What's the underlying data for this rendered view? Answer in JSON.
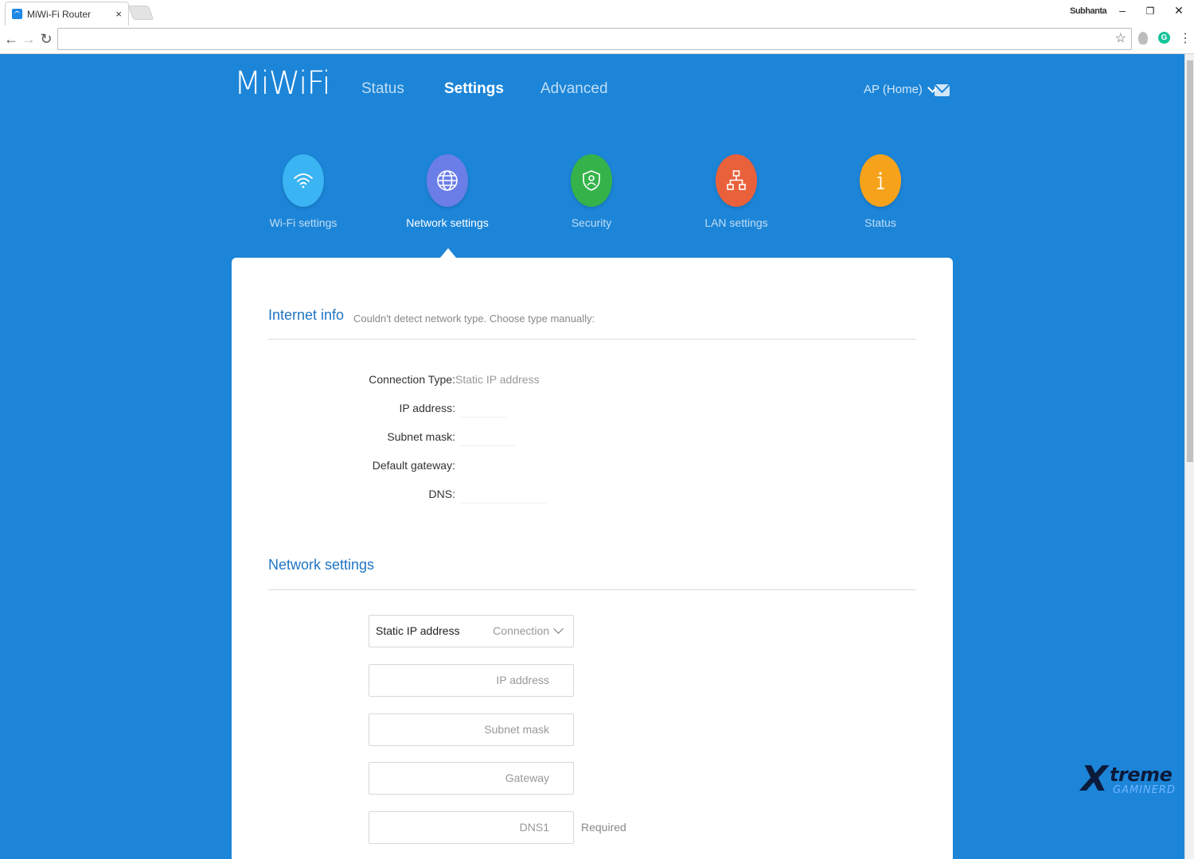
{
  "browser": {
    "tab_title": "MiWi-Fi Router",
    "tab_close": "×",
    "profile_name": "Subhanta",
    "minimize": "–",
    "restore": "❐",
    "close": "✕",
    "back": "←",
    "forward": "→",
    "reload": "↻",
    "url": "",
    "bookmark": "☆",
    "menu": "⋮",
    "extension_g": "G"
  },
  "header": {
    "logo": "MiWiFi",
    "nav": [
      {
        "label": "Status",
        "active": false
      },
      {
        "label": "Settings",
        "active": true
      },
      {
        "label": "Advanced",
        "active": false
      }
    ],
    "mode": "AP (Home)",
    "mail_icon": "mail-icon"
  },
  "categories": [
    {
      "label": "Wi-Fi settings",
      "icon": "wifi-icon",
      "color": "#3ab4f2"
    },
    {
      "label": "Network settings",
      "icon": "globe-icon",
      "color": "#6b7ee8",
      "active": true
    },
    {
      "label": "Security",
      "icon": "shield-icon",
      "color": "#35b34a"
    },
    {
      "label": "LAN settings",
      "icon": "network-icon",
      "color": "#e9613b"
    },
    {
      "label": "Status",
      "icon": "info-icon",
      "color": "#f7a21b"
    }
  ],
  "internet_info": {
    "title": "Internet info",
    "subtitle": "Couldn't detect network type. Choose type manually:",
    "rows": [
      {
        "label": "Connection Type:",
        "value": "Static IP address"
      },
      {
        "label": "IP address:",
        "value": ""
      },
      {
        "label": "Subnet mask:",
        "value": ""
      },
      {
        "label": "Default gateway:",
        "value": ""
      },
      {
        "label": "DNS:",
        "value": ""
      }
    ]
  },
  "network_settings": {
    "title": "Network settings",
    "connection_value": "Static IP address",
    "connection_label": "Connection",
    "ip_placeholder": "IP address",
    "subnet_placeholder": "Subnet mask",
    "gateway_placeholder": "Gateway",
    "dns1_placeholder": "DNS1",
    "dns1_hint": "Required"
  },
  "watermark": {
    "brand": "treme",
    "sub": "GAMINERD"
  },
  "colors": {
    "page_bg": "#1c85d8",
    "accent_text": "#1f74c4"
  }
}
